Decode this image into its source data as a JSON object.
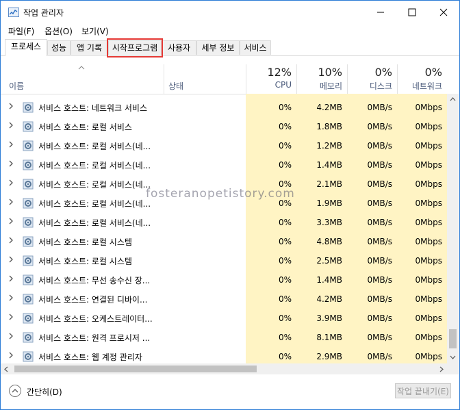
{
  "window": {
    "title": "작업 관리자",
    "minimize_label": "─",
    "maximize_label": "☐",
    "close_label": "✕"
  },
  "menu": {
    "file": "파일(F)",
    "options": "옵션(O)",
    "view": "보기(V)"
  },
  "tabs": [
    {
      "label": "프로세스",
      "active": true
    },
    {
      "label": "성능"
    },
    {
      "label": "앱 기록"
    },
    {
      "label": "시작프로그램",
      "highlighted": true
    },
    {
      "label": "사용자"
    },
    {
      "label": "세부 정보"
    },
    {
      "label": "서비스"
    }
  ],
  "columns": {
    "name": "이름",
    "status": "상태",
    "cpu": {
      "percent": "12%",
      "label": "CPU"
    },
    "memory": {
      "percent": "10%",
      "label": "메모리"
    },
    "disk": {
      "percent": "0%",
      "label": "디스크"
    },
    "network": {
      "percent": "0%",
      "label": "네트워크"
    }
  },
  "rows": [
    {
      "name": "서비스 호스트: 네트워크 서비스",
      "cpu": "0%",
      "memory": "4.2MB",
      "disk": "0MB/s",
      "network": "0Mbps"
    },
    {
      "name": "서비스 호스트: 로컬 서비스",
      "cpu": "0%",
      "memory": "1.8MB",
      "disk": "0MB/s",
      "network": "0Mbps"
    },
    {
      "name": "서비스 호스트: 로컬 서비스(네...",
      "cpu": "0%",
      "memory": "1.2MB",
      "disk": "0MB/s",
      "network": "0Mbps"
    },
    {
      "name": "서비스 호스트: 로컬 서비스(네...",
      "cpu": "0%",
      "memory": "1.4MB",
      "disk": "0MB/s",
      "network": "0Mbps"
    },
    {
      "name": "서비스 호스트: 로컬 서비스(네...",
      "cpu": "0%",
      "memory": "2.1MB",
      "disk": "0MB/s",
      "network": "0Mbps"
    },
    {
      "name": "서비스 호스트: 로컬 서비스(네...",
      "cpu": "0%",
      "memory": "1.9MB",
      "disk": "0MB/s",
      "network": "0Mbps"
    },
    {
      "name": "서비스 호스트: 로컬 서비스(네...",
      "cpu": "0%",
      "memory": "3.3MB",
      "disk": "0MB/s",
      "network": "0Mbps"
    },
    {
      "name": "서비스 호스트: 로컬 시스템",
      "cpu": "0%",
      "memory": "4.8MB",
      "disk": "0MB/s",
      "network": "0Mbps"
    },
    {
      "name": "서비스 호스트: 로컬 시스템",
      "cpu": "0%",
      "memory": "2.5MB",
      "disk": "0MB/s",
      "network": "0Mbps"
    },
    {
      "name": "서비스 호스트: 무선 송수신 장...",
      "cpu": "0%",
      "memory": "1.4MB",
      "disk": "0MB/s",
      "network": "0Mbps"
    },
    {
      "name": "서비스 호스트: 연결된 디바이...",
      "cpu": "0%",
      "memory": "4.2MB",
      "disk": "0MB/s",
      "network": "0Mbps"
    },
    {
      "name": "서비스 호스트: 오케스트레이터...",
      "cpu": "0%",
      "memory": "3.9MB",
      "disk": "0MB/s",
      "network": "0Mbps"
    },
    {
      "name": "서비스 호스트: 원격 프로시저 ...",
      "cpu": "0%",
      "memory": "8.1MB",
      "disk": "0MB/s",
      "network": "0Mbps"
    },
    {
      "name": "서비스 호스트: 웹 계정 관리자",
      "cpu": "0%",
      "memory": "2.9MB",
      "disk": "0MB/s",
      "network": "0Mbps"
    }
  ],
  "footer": {
    "collapse_label": "간단히(D)",
    "end_task_label": "작업 끝내기(E)"
  },
  "watermark": "fosteranopetistory.com",
  "colors": {
    "highlight_border": "#e53935",
    "column_heat": "#fff4c4",
    "window_border": "#2b7bd6"
  },
  "icons": {
    "row_icon": "gear-icon",
    "expand": "chevron-right-icon",
    "sort": "sort-up-icon",
    "collapse": "chevron-up-circle-icon"
  }
}
